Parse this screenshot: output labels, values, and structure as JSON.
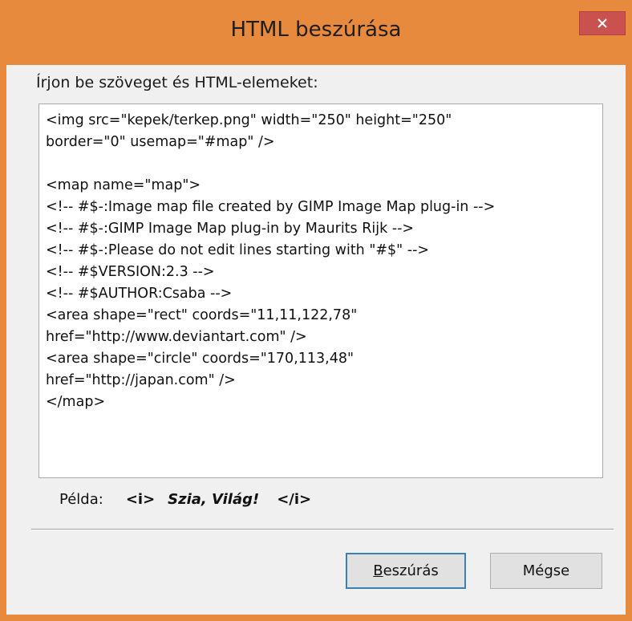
{
  "window": {
    "title": "HTML beszúrása",
    "close_glyph": "✕",
    "accent_color": "#e78a3e",
    "close_color": "#c9524f"
  },
  "dialog": {
    "prompt": "Írjon be szöveget és HTML-elemeket:",
    "code_lines": [
      "<img src=\"kepek/terkep.png\" width=\"250\" height=\"250\"",
      "border=\"0\" usemap=\"#map\" />",
      "",
      "<map name=\"map\">",
      "<!-- #$-:Image map file created by GIMP Image Map plug-in -->",
      "<!-- #$-:GIMP Image Map plug-in by Maurits Rijk -->",
      "<!-- #$-:Please do not edit lines starting with \"#$\" -->",
      "<!-- #$VERSION:2.3 -->",
      "<!-- #$AUTHOR:Csaba -->",
      "<area shape=\"rect\" coords=\"11,11,122,78\"",
      "href=\"http://www.deviantart.com\" />",
      "<area shape=\"circle\" coords=\"170,113,48\"",
      "href=\"http://japan.com\" />",
      "</map>"
    ],
    "example": {
      "label": "Példa:",
      "open_tag": "<i>",
      "text": "Szia, Világ!",
      "close_tag": "</i>"
    }
  },
  "buttons": {
    "insert_accel": "B",
    "insert_rest": "eszúrás",
    "cancel": "Mégse"
  }
}
